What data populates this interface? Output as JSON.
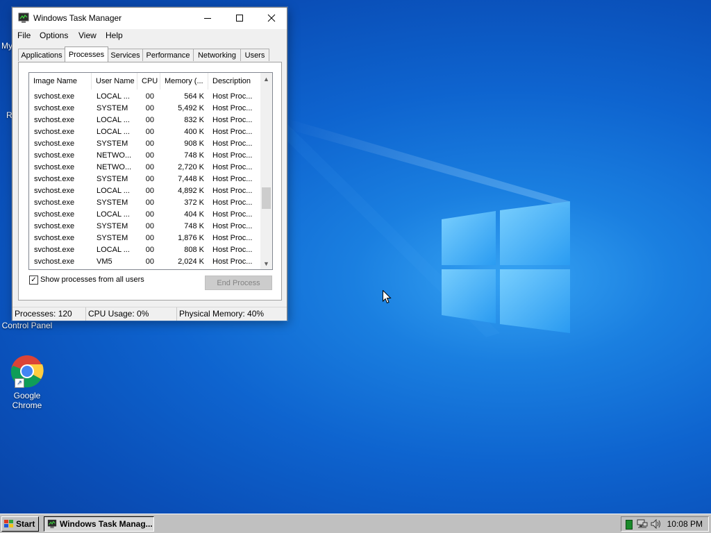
{
  "desktop": {
    "partial_labels": [
      "My",
      "R"
    ],
    "icons": [
      {
        "label": "Control Panel",
        "icon": "control-panel-icon"
      },
      {
        "label_line1": "Google",
        "label_line2": "Chrome",
        "icon": "chrome-icon"
      }
    ]
  },
  "window": {
    "title": "Windows Task Manager",
    "menu": [
      "File",
      "Options",
      "View",
      "Help"
    ],
    "tabs": [
      "Applications",
      "Processes",
      "Services",
      "Performance",
      "Networking",
      "Users"
    ],
    "active_tab": "Processes",
    "columns": [
      "Image Name",
      "User Name",
      "CPU",
      "Memory (...",
      "Description"
    ],
    "rows": [
      {
        "image": "svchost.exe",
        "user": "LOCAL ...",
        "cpu": "00",
        "mem": "564 K",
        "desc": "Host Proc..."
      },
      {
        "image": "svchost.exe",
        "user": "SYSTEM",
        "cpu": "00",
        "mem": "5,492 K",
        "desc": "Host Proc..."
      },
      {
        "image": "svchost.exe",
        "user": "LOCAL ...",
        "cpu": "00",
        "mem": "832 K",
        "desc": "Host Proc..."
      },
      {
        "image": "svchost.exe",
        "user": "LOCAL ...",
        "cpu": "00",
        "mem": "400 K",
        "desc": "Host Proc..."
      },
      {
        "image": "svchost.exe",
        "user": "SYSTEM",
        "cpu": "00",
        "mem": "908 K",
        "desc": "Host Proc..."
      },
      {
        "image": "svchost.exe",
        "user": "NETWO...",
        "cpu": "00",
        "mem": "748 K",
        "desc": "Host Proc..."
      },
      {
        "image": "svchost.exe",
        "user": "NETWO...",
        "cpu": "00",
        "mem": "2,720 K",
        "desc": "Host Proc..."
      },
      {
        "image": "svchost.exe",
        "user": "SYSTEM",
        "cpu": "00",
        "mem": "7,448 K",
        "desc": "Host Proc..."
      },
      {
        "image": "svchost.exe",
        "user": "LOCAL ...",
        "cpu": "00",
        "mem": "4,892 K",
        "desc": "Host Proc..."
      },
      {
        "image": "svchost.exe",
        "user": "SYSTEM",
        "cpu": "00",
        "mem": "372 K",
        "desc": "Host Proc..."
      },
      {
        "image": "svchost.exe",
        "user": "LOCAL ...",
        "cpu": "00",
        "mem": "404 K",
        "desc": "Host Proc..."
      },
      {
        "image": "svchost.exe",
        "user": "SYSTEM",
        "cpu": "00",
        "mem": "748 K",
        "desc": "Host Proc..."
      },
      {
        "image": "svchost.exe",
        "user": "SYSTEM",
        "cpu": "00",
        "mem": "1,876 K",
        "desc": "Host Proc..."
      },
      {
        "image": "svchost.exe",
        "user": "LOCAL ...",
        "cpu": "00",
        "mem": "808 K",
        "desc": "Host Proc..."
      },
      {
        "image": "svchost.exe",
        "user": "VM5",
        "cpu": "00",
        "mem": "2,024 K",
        "desc": "Host Proc..."
      }
    ],
    "show_all_users_label": "Show processes from all users",
    "show_all_users_checked": true,
    "end_process_label": "End Process",
    "status": {
      "processes": "Processes: 120",
      "cpu": "CPU Usage: 0%",
      "memory": "Physical Memory: 40%"
    }
  },
  "taskbar": {
    "start_label": "Start",
    "task_label": "Windows Task Manag...",
    "clock": "10:08 PM",
    "tray_icons": [
      "green-status-icon",
      "network-icon",
      "volume-icon"
    ]
  },
  "colors": {
    "desktop_blue": "#0e64cf",
    "taskbar_gray": "#c0c0c0",
    "window_bg": "#f0f0f0"
  }
}
